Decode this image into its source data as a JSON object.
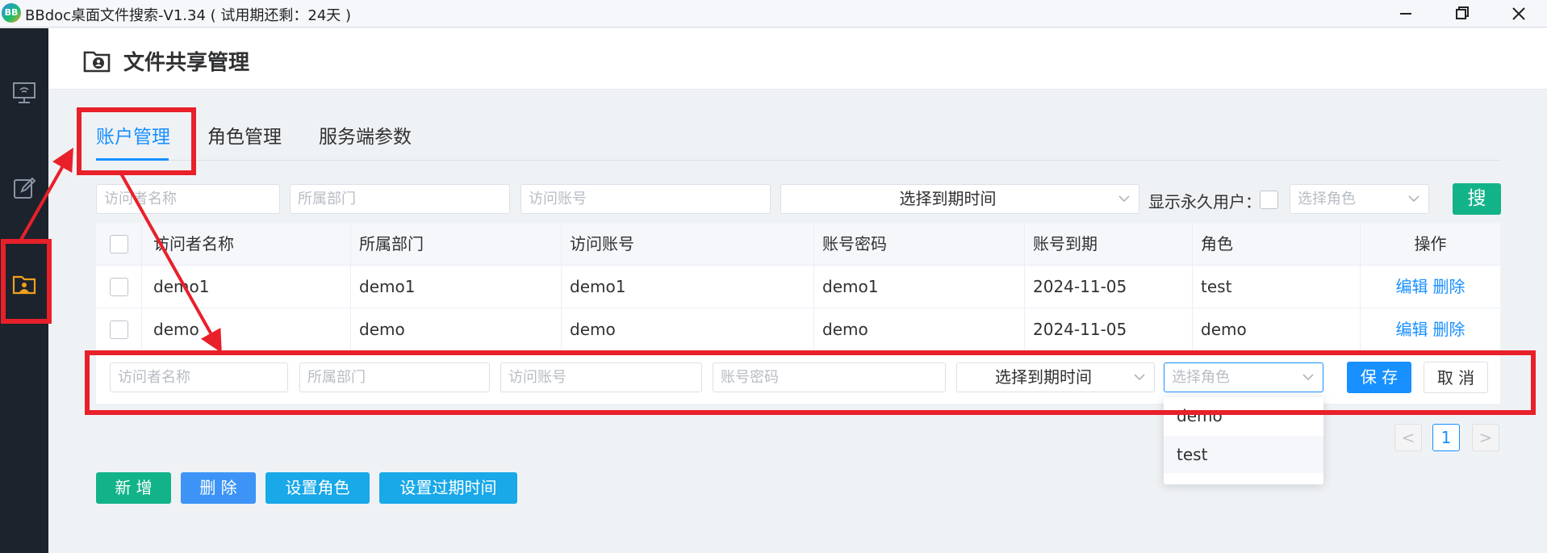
{
  "window": {
    "title": "BBdoc桌面文件搜索-V1.34 ( 试用期还剩：24天 )",
    "logo_text": "BB",
    "minimize_icon": "minimize-icon",
    "maximize_icon": "restore-icon",
    "close_icon": "close-icon"
  },
  "sidebar": {
    "items": [
      {
        "icon": "monitor-wifi-icon",
        "active": false
      },
      {
        "icon": "edit-note-icon",
        "active": false
      },
      {
        "icon": "shared-folder-icon",
        "active": true
      }
    ]
  },
  "header": {
    "title": "文件共享管理",
    "icon": "shared-folder-icon"
  },
  "tabs": [
    {
      "label": "账户管理",
      "active": true
    },
    {
      "label": "角色管理",
      "active": false
    },
    {
      "label": "服务端参数",
      "active": false
    }
  ],
  "filters": {
    "visitor_name_placeholder": "访问者名称",
    "department_placeholder": "所属部门",
    "account_placeholder": "访问账号",
    "expiry_select": "选择到期时间",
    "permanent_label": "显示永久用户：",
    "role_placeholder": "选择角色",
    "search_label": "搜"
  },
  "table": {
    "headers": [
      "访问者名称",
      "所属部门",
      "访问账号",
      "账号密码",
      "账号到期",
      "角色",
      "操作"
    ],
    "rows": [
      {
        "name": "demo1",
        "dept": "demo1",
        "account": "demo1",
        "password": "demo1",
        "expiry": "2024-11-05",
        "role": "test"
      },
      {
        "name": "demo",
        "dept": "demo",
        "account": "demo",
        "password": "demo",
        "expiry": "2024-11-05",
        "role": "demo"
      }
    ],
    "edit_label": "编辑",
    "delete_label": "删除"
  },
  "edit_row": {
    "visitor_name_placeholder": "访问者名称",
    "department_placeholder": "所属部门",
    "account_placeholder": "访问账号",
    "password_placeholder": "账号密码",
    "expiry_select": "选择到期时间",
    "role_placeholder": "选择角色",
    "save_label": "保 存",
    "cancel_label": "取 消"
  },
  "role_dropdown": {
    "options": [
      "demo",
      "test"
    ],
    "hovered": "test"
  },
  "pagination": {
    "prev": "<",
    "current": "1",
    "next": ">"
  },
  "actions": {
    "add_label": "新 增",
    "delete_label": "删 除",
    "set_role_label": "设置角色",
    "set_expiry_label": "设置过期时间"
  },
  "colors": {
    "accent": "#1890ff",
    "teal": "#13b38a",
    "sky": "#19a8e8",
    "sidebar_bg": "#1d232d",
    "annotation": "#e8202a"
  }
}
